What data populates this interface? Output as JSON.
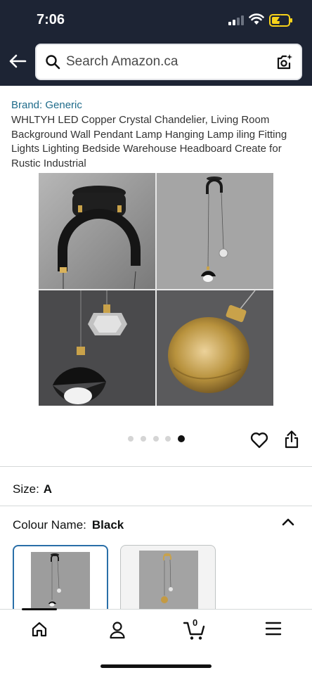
{
  "status_bar": {
    "time": "7:06"
  },
  "search": {
    "placeholder": "Search Amazon.ca"
  },
  "product": {
    "brand": "Brand: Generic",
    "title": "WHLTYH LED Copper Crystal Chandelier, Living Room Background Wall Pendant Lamp Hanging Lamp iling Fitting Lights Lighting Bedside Warehouse Headboard Create for Rustic Industrial"
  },
  "gallery": {
    "dot_count": 5,
    "active_index": 4
  },
  "options": {
    "size_label": "Size:",
    "size_value": "A",
    "colour_label": "Colour Name:",
    "colour_value": "Black"
  },
  "swatches": [
    {
      "selected": true
    },
    {
      "selected": false
    }
  ],
  "bottom_nav": {
    "items": [
      "home-icon",
      "account-icon",
      "cart-icon",
      "menu-icon"
    ],
    "cart_count": "0"
  },
  "colors": {
    "header_bg": "#1d2434",
    "brand_link": "#1f6b8a",
    "selected_border": "#2a6fa8",
    "battery": "#f7d21a"
  }
}
